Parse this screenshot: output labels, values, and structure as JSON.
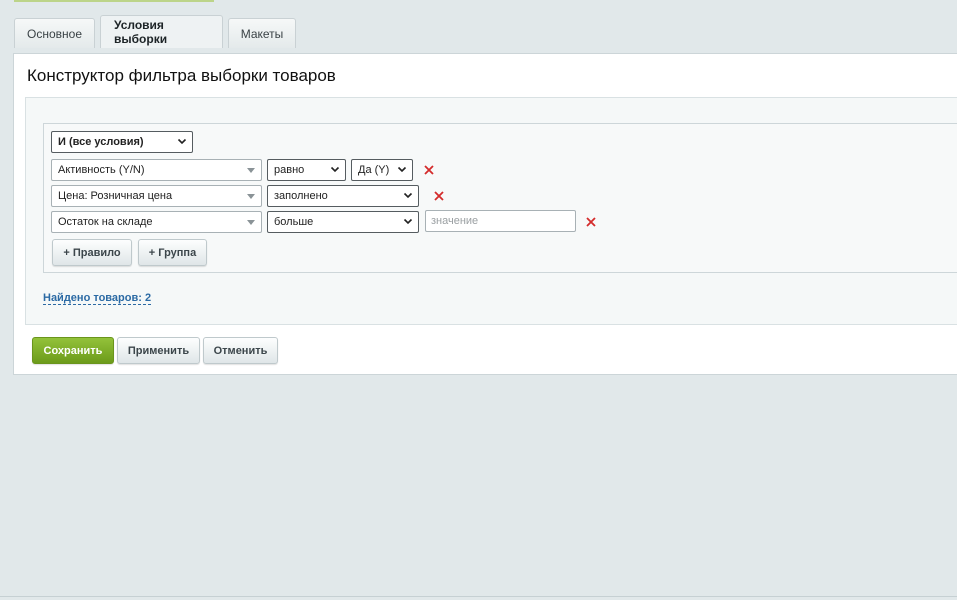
{
  "tabs": [
    {
      "label": "Основное",
      "active": false
    },
    {
      "label": "Условия выборки",
      "active": true
    },
    {
      "label": "Макеты",
      "active": false
    }
  ],
  "panel": {
    "title": "Конструктор фильтра выборки товаров"
  },
  "group": {
    "logic_select": "И (все условия)"
  },
  "rules": [
    {
      "field": "Активность (Y/N)",
      "operator": "равно",
      "value": "Да (Y)"
    },
    {
      "field": "Цена: Розничная цена",
      "operator": "заполнено"
    },
    {
      "field": "Остаток на складе",
      "operator": "больше",
      "value_placeholder": "значение"
    }
  ],
  "actions": {
    "add_rule": "+ Правило",
    "add_group": "+ Группа"
  },
  "found_link": "Найдено товаров: 2",
  "footer": {
    "save": "Сохранить",
    "apply": "Применить",
    "cancel": "Отменить"
  },
  "colors": {
    "accent_green": "#7aab22",
    "link_blue": "#2b6aa4",
    "delete_red": "#d42b2b"
  }
}
